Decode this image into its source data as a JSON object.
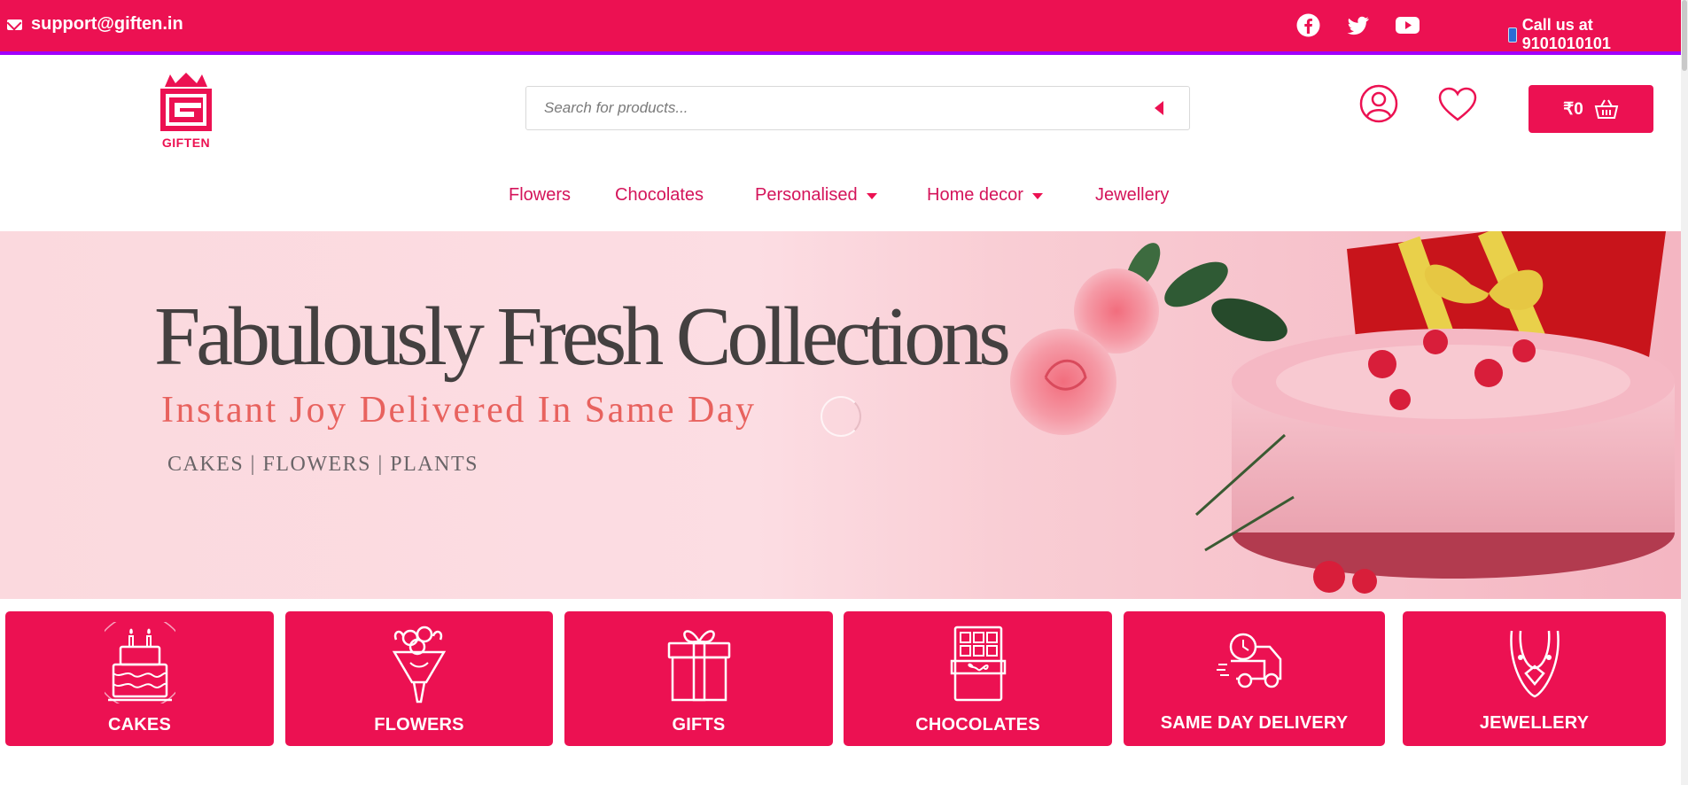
{
  "topbar": {
    "email": "support@giften.in",
    "call_text": "Call us at 9101010101",
    "social_icons": [
      "facebook-icon",
      "twitter-icon",
      "youtube-icon"
    ]
  },
  "header": {
    "logo_text": "GIFTEN",
    "search_placeholder": "Search for products...",
    "cart_amount": "₹0"
  },
  "nav": {
    "items": [
      {
        "label": "Flowers",
        "has_dropdown": false
      },
      {
        "label": "Chocolates",
        "has_dropdown": false
      },
      {
        "label": "Personalised",
        "has_dropdown": true
      },
      {
        "label": "Home decor",
        "has_dropdown": true
      },
      {
        "label": "Jewellery",
        "has_dropdown": false
      }
    ]
  },
  "banner": {
    "title": "Fabulously Fresh Collections",
    "subtitle": "Instant Joy Delivered In Same Day",
    "tagline": "CAKES | FLOWERS | PLANTS"
  },
  "categories": [
    {
      "label": "CAKES",
      "icon": "cake-icon"
    },
    {
      "label": "FLOWERS",
      "icon": "bouquet-icon"
    },
    {
      "label": "GIFTS",
      "icon": "gift-icon"
    },
    {
      "label": "CHOCOLATES",
      "icon": "chocolate-icon"
    },
    {
      "label": "SAME DAY DELIVERY",
      "icon": "delivery-truck-icon"
    },
    {
      "label": "JEWELLERY",
      "icon": "necklace-icon"
    }
  ],
  "colors": {
    "brand": "#ec1152",
    "topbar_border": "#a100ff",
    "nav_text": "#d4145a",
    "banner_subtitle": "#e8625e"
  }
}
